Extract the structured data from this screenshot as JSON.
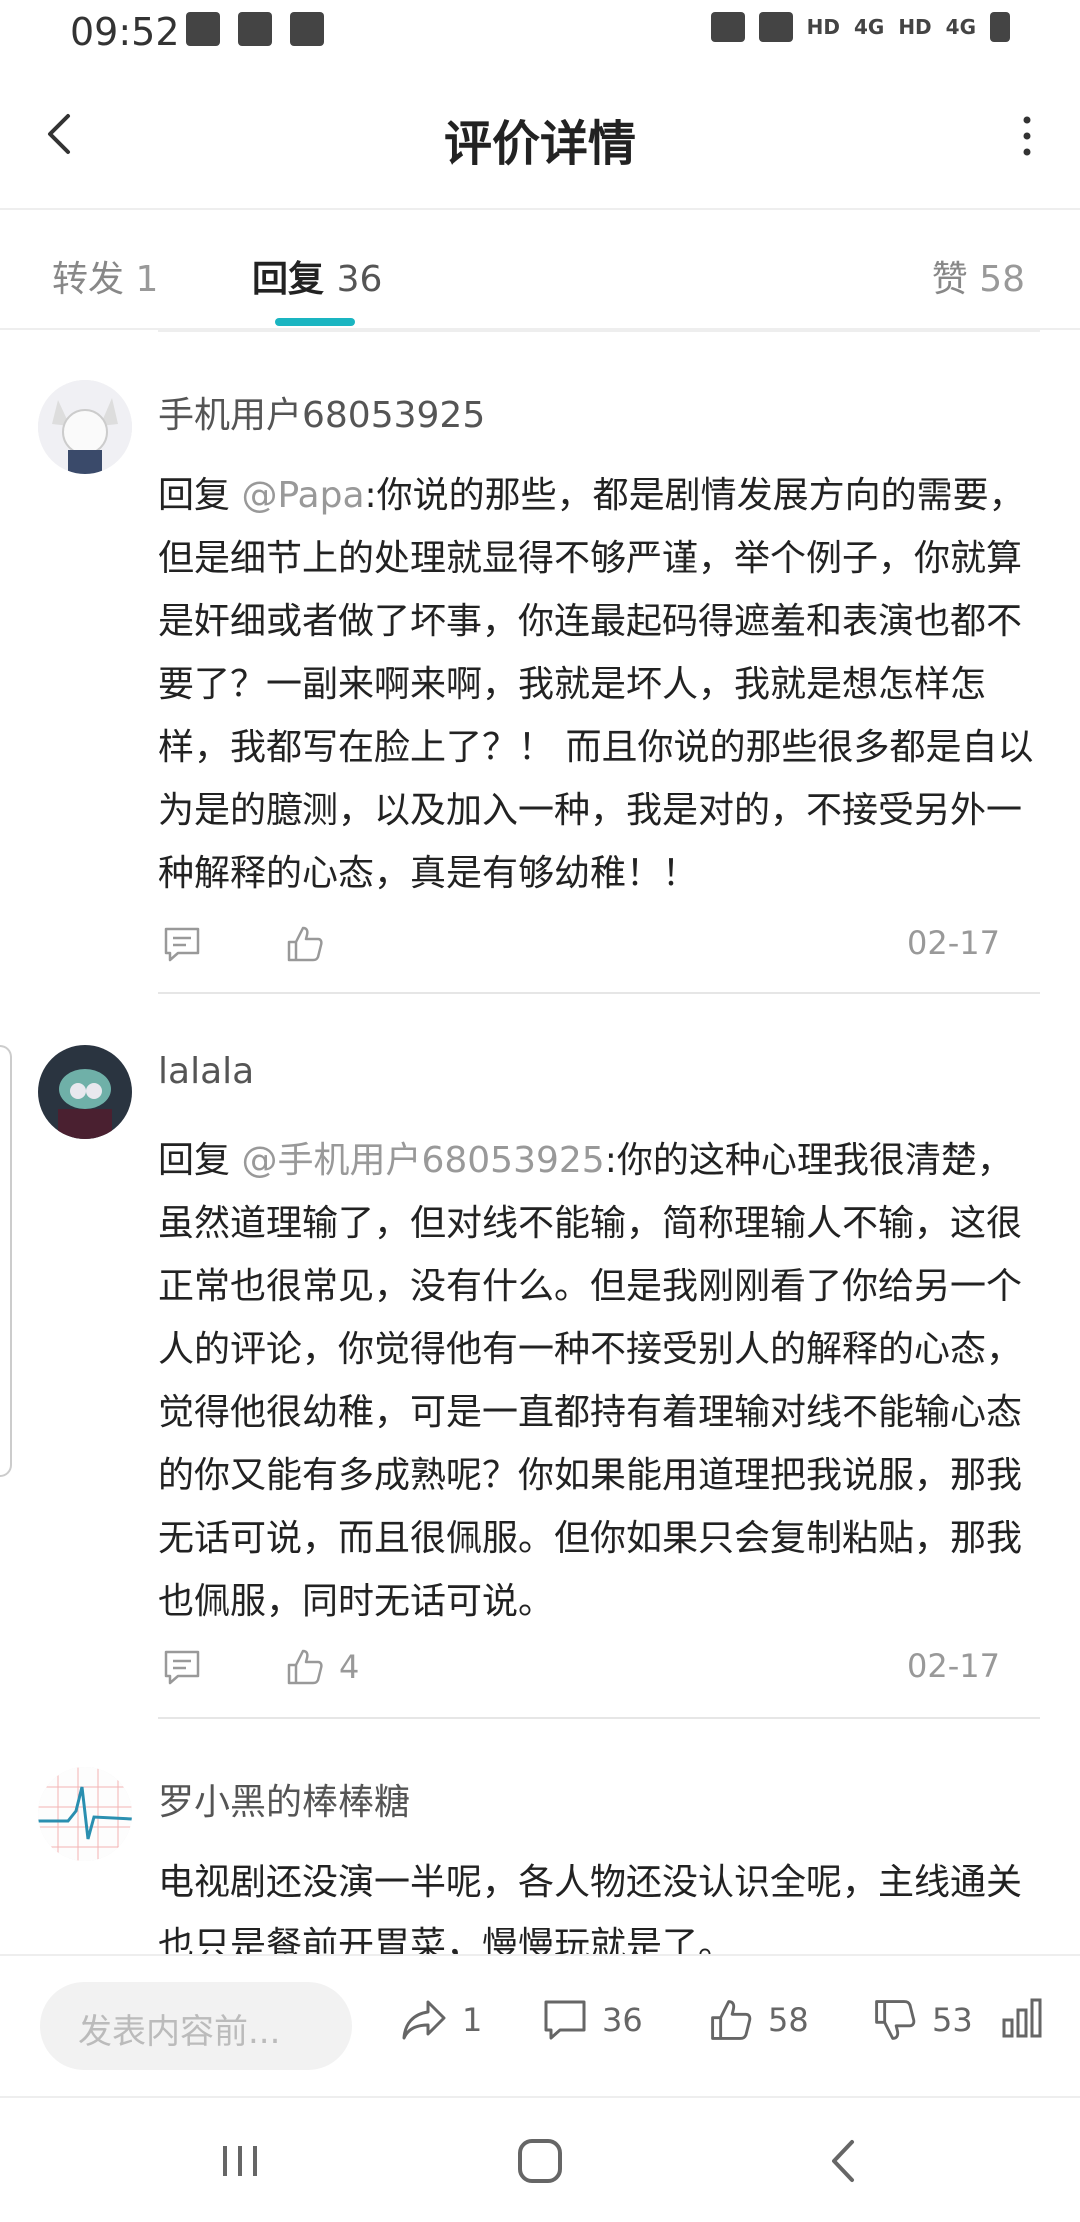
{
  "status_bar": {
    "time": "09:52",
    "labels": [
      "HD",
      "4G",
      "HD",
      "4G"
    ]
  },
  "header": {
    "title": "评价详情"
  },
  "tabs": [
    {
      "label": "转发",
      "count": "1"
    },
    {
      "label": "回复",
      "count": "36"
    },
    {
      "label": "赞",
      "count": "58"
    }
  ],
  "comments": [
    {
      "username": "手机用户68053925",
      "reply_prefix": "回复 ",
      "mention": "@Papa",
      "text": ":你说的那些，都是剧情发展方向的需要，但是细节上的处理就显得不够严谨，举个例子，你就算是奸细或者做了坏事，你连最起码得遮羞和表演也都不要了？一副来啊来啊，我就是坏人，我就是想怎样怎样，我都写在脸上了？！ 而且你说的那些很多都是自以为是的臆测，以及加入一种，我是对的，不接受另外一种解释的心态，真是有够幼稚！！",
      "likes": "",
      "date": "02-17"
    },
    {
      "username": "lalala",
      "reply_prefix": "回复 ",
      "mention": "@手机用户68053925",
      "text": ":你的这种心理我很清楚，虽然道理输了，但对线不能输，简称理输人不输，这很正常也很常见，没有什么。但是我刚刚看了你给另一个人的评论，你觉得他有一种不接受别人的解释的心态，觉得他很幼稚，可是一直都持有着理输对线不能输心态的你又能有多成熟呢？你如果能用道理把我说服，那我无话可说，而且很佩服。但你如果只会复制粘贴，那我也佩服，同时无话可说。",
      "likes": "4",
      "date": "02-17"
    },
    {
      "username": "罗小黑的棒棒糖",
      "text": "电视剧还没演一半呢，各人物还没认识全呢，主线通关也只是餐前开胃菜，慢慢玩就是了。"
    }
  ],
  "bottom_bar": {
    "input_placeholder": "发表内容前...",
    "share_count": "1",
    "reply_count": "36",
    "like_count": "58",
    "dislike_count": "53"
  },
  "colors": {
    "accent": "#1ab5c1",
    "muted": "#999999"
  }
}
